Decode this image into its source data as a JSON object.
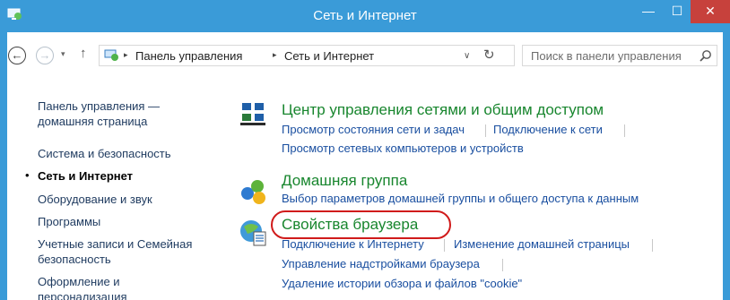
{
  "window": {
    "title": "Сеть и Интернет",
    "minimize_glyph": "—",
    "maximize_glyph": "☐",
    "close_glyph": "✕",
    "app_icon": "control-panel-icon"
  },
  "nav": {
    "back_glyph": "←",
    "forward_glyph": "→",
    "dropdown_glyph": "▾",
    "up_glyph": "↑",
    "breadcrumbs": [
      "Панель управления",
      "Сеть и Интернет"
    ],
    "breadcrumb_separator": "▸",
    "address_chevron": "∨",
    "refresh_glyph": "↻",
    "search_placeholder": "Поиск в панели управления"
  },
  "sidebar": {
    "items": [
      {
        "label": "Панель управления —"
      },
      {
        "label": "домашняя страница"
      },
      {
        "label": "Система и безопасность"
      },
      {
        "label": "Сеть и Интернет",
        "current": true
      },
      {
        "label": "Оборудование и звук"
      },
      {
        "label": "Программы"
      },
      {
        "label": "Учетные записи и Семейная"
      },
      {
        "label": "безопасность"
      },
      {
        "label": "Оформление и"
      },
      {
        "label": "персонализация"
      }
    ],
    "bullet": "•"
  },
  "categories": [
    {
      "title": "Центр управления сетями и общим доступом",
      "icon": "network-center-icon",
      "links": [
        "Просмотр состояния сети и задач",
        "Подключение к сети",
        "Просмотр сетевых компьютеров и устройств"
      ]
    },
    {
      "title": "Домашняя группа",
      "icon": "homegroup-icon",
      "links": [
        "Выбор параметров домашней группы и общего доступа к данным"
      ]
    },
    {
      "title": "Свойства браузера",
      "icon": "internet-options-icon",
      "links": [
        "Подключение к Интернету",
        "Изменение домашней страницы",
        "Управление надстройками браузера",
        "Удаление истории обзора и файлов \"cookie\""
      ]
    }
  ],
  "colors": {
    "titlebar": "#3a9bd8",
    "close_button": "#c7413c",
    "category_title": "#18862e",
    "link": "#1a4fa0",
    "highlight_ring": "#d01b1b"
  }
}
